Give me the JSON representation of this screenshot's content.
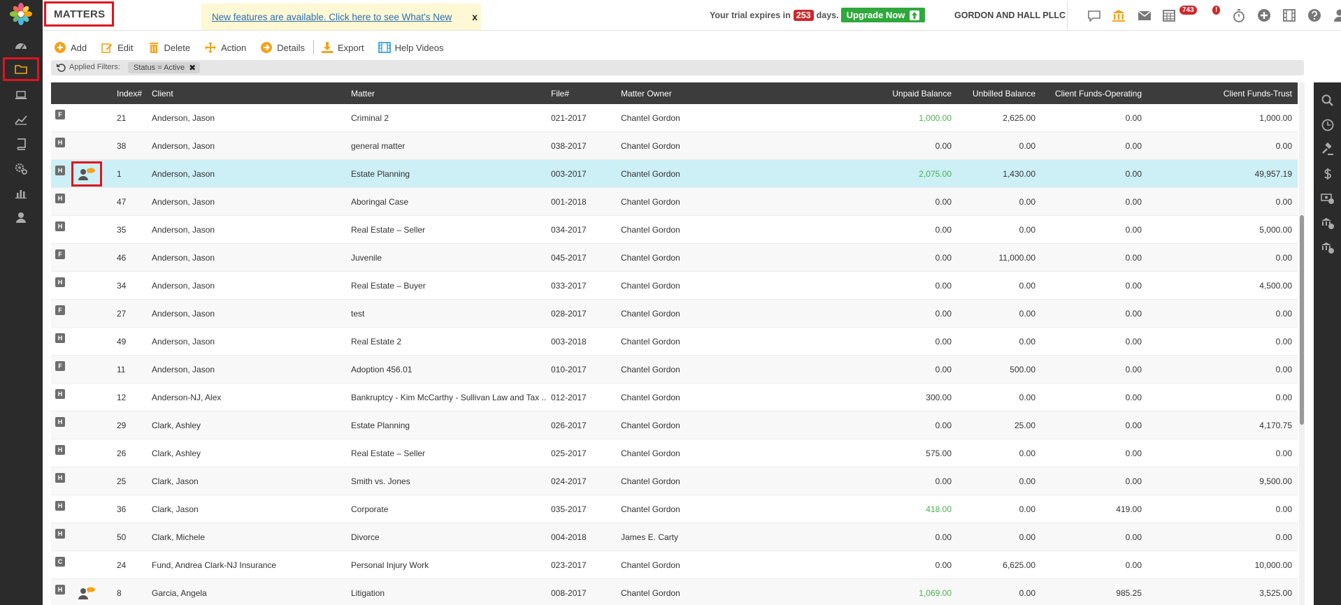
{
  "header": {
    "title": "MATTERS",
    "news_link": "New features are available. Click here to see What's New",
    "news_close": "x",
    "trial_prefix": "Your trial expires in",
    "trial_days": "253",
    "trial_suffix": "days.",
    "upgrade_label": "Upgrade Now",
    "firm_name": "GORDON AND HALL PLLC",
    "mail_badge": "743",
    "calendar_badge": "!"
  },
  "toolbar": {
    "add": "Add",
    "edit": "Edit",
    "delete": "Delete",
    "action": "Action",
    "details": "Details",
    "export": "Export",
    "help_videos": "Help Videos"
  },
  "filters": {
    "label": "Applied Filters:",
    "chip": "Status = Active",
    "chip_remove": "✖"
  },
  "table": {
    "columns": [
      "Index#",
      "Client",
      "Matter",
      "File#",
      "Matter Owner",
      "Unpaid Balance",
      "Unbilled Balance",
      "Client Funds-Operating",
      "Client Funds-Trust"
    ],
    "rows": [
      {
        "type": "F",
        "index": "21",
        "client": "Anderson, Jason",
        "matter": "Criminal 2",
        "file": "021-2017",
        "owner": "Chantel Gordon",
        "unpaid": "1,000.00",
        "unpaid_green": true,
        "unbilled": "2,625.00",
        "operating": "0.00",
        "trust": "1,000.00"
      },
      {
        "type": "H",
        "index": "38",
        "client": "Anderson, Jason",
        "matter": "general matter",
        "file": "038-2017",
        "owner": "Chantel Gordon",
        "unpaid": "0.00",
        "unbilled": "0.00",
        "operating": "0.00",
        "trust": "0.00"
      },
      {
        "type": "H",
        "index": "1",
        "client": "Anderson, Jason",
        "matter": "Estate Planning",
        "file": "003-2017",
        "owner": "Chantel Gordon",
        "unpaid": "2,075.00",
        "unpaid_green": true,
        "unbilled": "1,430.00",
        "operating": "0.00",
        "trust": "49,957.19",
        "portal": true,
        "selected": true
      },
      {
        "type": "H",
        "index": "47",
        "client": "Anderson, Jason",
        "matter": "Aboringal Case",
        "file": "001-2018",
        "owner": "Chantel Gordon",
        "unpaid": "0.00",
        "unbilled": "0.00",
        "operating": "0.00",
        "trust": "0.00"
      },
      {
        "type": "H",
        "index": "35",
        "client": "Anderson, Jason",
        "matter": "Real Estate – Seller",
        "file": "034-2017",
        "owner": "Chantel Gordon",
        "unpaid": "0.00",
        "unbilled": "0.00",
        "operating": "0.00",
        "trust": "5,000.00"
      },
      {
        "type": "F",
        "index": "46",
        "client": "Anderson, Jason",
        "matter": "Juvenile",
        "file": "045-2017",
        "owner": "Chantel Gordon",
        "unpaid": "0.00",
        "unbilled": "11,000.00",
        "operating": "0.00",
        "trust": "0.00"
      },
      {
        "type": "H",
        "index": "34",
        "client": "Anderson, Jason",
        "matter": "Real Estate – Buyer",
        "file": "033-2017",
        "owner": "Chantel Gordon",
        "unpaid": "0.00",
        "unbilled": "0.00",
        "operating": "0.00",
        "trust": "4,500.00"
      },
      {
        "type": "F",
        "index": "27",
        "client": "Anderson, Jason",
        "matter": "test",
        "file": "028-2017",
        "owner": "Chantel Gordon",
        "unpaid": "0.00",
        "unbilled": "0.00",
        "operating": "0.00",
        "trust": "0.00"
      },
      {
        "type": "H",
        "index": "49",
        "client": "Anderson, Jason",
        "matter": "Real Estate 2",
        "file": "003-2018",
        "owner": "Chantel Gordon",
        "unpaid": "0.00",
        "unbilled": "0.00",
        "operating": "0.00",
        "trust": "0.00"
      },
      {
        "type": "F",
        "index": "11",
        "client": "Anderson, Jason",
        "matter": "Adoption 456.01",
        "file": "010-2017",
        "owner": "Chantel Gordon",
        "unpaid": "0.00",
        "unbilled": "500.00",
        "operating": "0.00",
        "trust": "0.00"
      },
      {
        "type": "H",
        "index": "12",
        "client": "Anderson-NJ, Alex",
        "matter": "Bankruptcy - Kim McCarthy - Sullivan Law and Tax ...",
        "file": "012-2017",
        "owner": "Chantel Gordon",
        "unpaid": "300.00",
        "unbilled": "0.00",
        "operating": "0.00",
        "trust": "0.00"
      },
      {
        "type": "H",
        "index": "29",
        "client": "Clark, Ashley",
        "matter": "Estate Planning",
        "file": "026-2017",
        "owner": "Chantel Gordon",
        "unpaid": "0.00",
        "unbilled": "25.00",
        "operating": "0.00",
        "trust": "4,170.75"
      },
      {
        "type": "H",
        "index": "26",
        "client": "Clark, Ashley",
        "matter": "Real Estate – Seller",
        "file": "025-2017",
        "owner": "Chantel Gordon",
        "unpaid": "575.00",
        "unbilled": "0.00",
        "operating": "0.00",
        "trust": "0.00"
      },
      {
        "type": "H",
        "index": "25",
        "client": "Clark, Jason",
        "matter": "Smith vs. Jones",
        "file": "024-2017",
        "owner": "Chantel Gordon",
        "unpaid": "0.00",
        "unbilled": "0.00",
        "operating": "0.00",
        "trust": "9,500.00"
      },
      {
        "type": "H",
        "index": "36",
        "client": "Clark, Jason",
        "matter": "Corporate",
        "file": "035-2017",
        "owner": "Chantel Gordon",
        "unpaid": "418.00",
        "unpaid_green": true,
        "unbilled": "0.00",
        "operating": "419.00",
        "trust": "0.00"
      },
      {
        "type": "H",
        "index": "50",
        "client": "Clark, Michele",
        "matter": "Divorce",
        "file": "004-2018",
        "owner": "James E. Carty",
        "unpaid": "0.00",
        "unbilled": "0.00",
        "operating": "0.00",
        "trust": "0.00"
      },
      {
        "type": "C",
        "index": "24",
        "client": "Fund, Andrea Clark-NJ Insurance",
        "matter": "Personal Injury Work",
        "file": "023-2017",
        "owner": "Chantel Gordon",
        "unpaid": "0.00",
        "unbilled": "6,625.00",
        "operating": "0.00",
        "trust": "10,000.00"
      },
      {
        "type": "H",
        "index": "8",
        "client": "Garcia, Angela",
        "matter": "Litigation",
        "file": "008-2017",
        "owner": "Chantel Gordon",
        "unpaid": "1,069.00",
        "unpaid_green": true,
        "unbilled": "0.00",
        "operating": "985.25",
        "trust": "3,525.00",
        "portal": true
      }
    ]
  },
  "colors": {
    "sidebar": "#2b2b2b",
    "header_row": "#3c3c3c",
    "accent_orange": "#f5a31a",
    "highlight_red": "#e0141e",
    "selected_row": "#cdeff6",
    "positive_green": "#4caf50",
    "upgrade_green": "#2fa83c"
  }
}
